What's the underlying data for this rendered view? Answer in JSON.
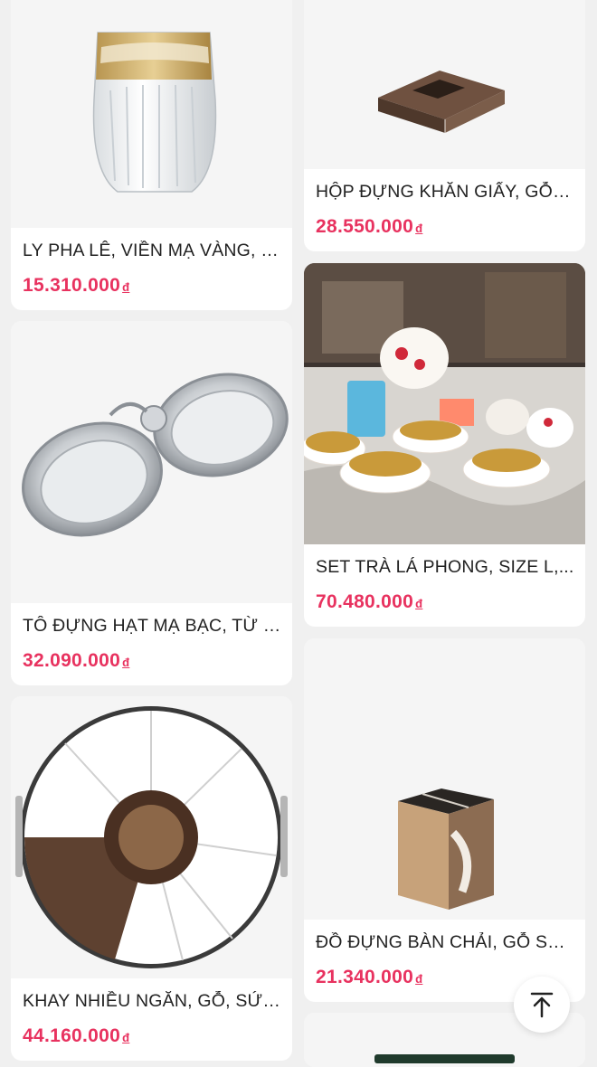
{
  "products": [
    {
      "name": "LY PHA LÊ, VIỀN MẠ VÀNG, H...",
      "price": "15.310.000",
      "currency": "đ",
      "image": "crystal-glass-gold-rim"
    },
    {
      "name": "HỘP ĐỰNG KHĂN GIẤY, GỖ S...",
      "price": "28.550.000",
      "currency": "đ",
      "image": "wooden-tissue-box"
    },
    {
      "name": "TÔ ĐỰNG HẠT MẠ BẠC, TỪ P...",
      "price": "32.090.000",
      "currency": "đ",
      "image": "silver-double-bowl"
    },
    {
      "name": "SET TRÀ LÁ PHONG, SIZE L,...",
      "price": "70.480.000",
      "currency": "đ",
      "image": "maple-leaf-tea-set"
    },
    {
      "name": "KHAY NHIỀU NGĂN, GỖ, SỨ,...",
      "price": "44.160.000",
      "currency": "đ",
      "image": "multi-compartment-tray"
    },
    {
      "name": "ĐỒ ĐỰNG BÀN CHẢI, GỖ SỒI...",
      "price": "21.340.000",
      "currency": "đ",
      "image": "wooden-toothbrush-holder"
    }
  ],
  "scroll_top_icon": "arrow-up-to-line-icon"
}
